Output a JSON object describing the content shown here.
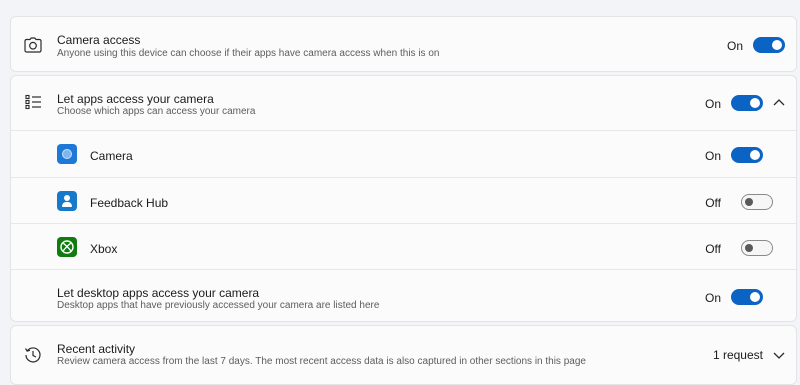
{
  "camera_access": {
    "title": "Camera access",
    "description": "Anyone using this device can choose if their apps have camera access when this is on",
    "state": "On",
    "enabled": true
  },
  "apps_access": {
    "title": "Let apps access your camera",
    "description": "Choose which apps can access your camera",
    "state": "On",
    "enabled": true,
    "expanded": true,
    "apps": [
      {
        "name": "Camera",
        "state": "On",
        "enabled": true,
        "icon": "camera-app-icon",
        "color": "#1e78d6"
      },
      {
        "name": "Feedback Hub",
        "state": "Off",
        "enabled": false,
        "icon": "feedback-hub-icon",
        "color": "#1779c9"
      },
      {
        "name": "Xbox",
        "state": "Off",
        "enabled": false,
        "icon": "xbox-icon",
        "color": "#107c10"
      }
    ],
    "desktop": {
      "title": "Let desktop apps access your camera",
      "description": "Desktop apps that have previously accessed your camera are listed here",
      "state": "On",
      "enabled": true
    }
  },
  "recent_activity": {
    "title": "Recent activity",
    "description": "Review camera access from the last 7 days. The most recent access data is also captured in other sections in this page",
    "summary": "1 request"
  },
  "colors": {
    "accent": "#0b63c4",
    "background": "#f3f4f8",
    "card": "#fbfbfc"
  }
}
